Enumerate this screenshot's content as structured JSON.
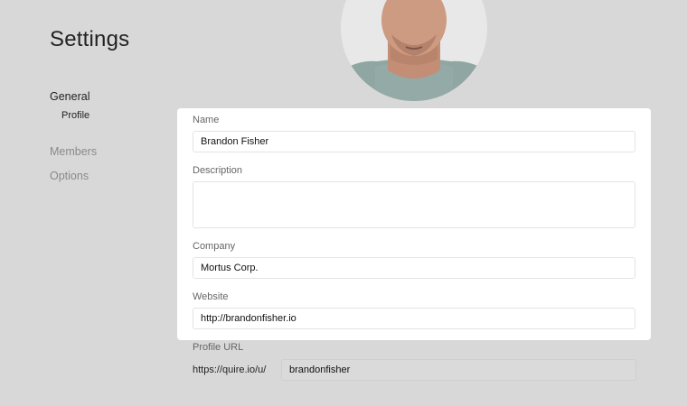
{
  "page": {
    "title": "Settings"
  },
  "nav": {
    "general": "General",
    "profile": "Profile",
    "members": "Members",
    "options": "Options"
  },
  "form": {
    "name": {
      "label": "Name",
      "value": "Brandon Fisher"
    },
    "description": {
      "label": "Description",
      "value": ""
    },
    "company": {
      "label": "Company",
      "value": "Mortus Corp."
    },
    "website": {
      "label": "Website",
      "value": "http://brandonfisher.io"
    },
    "profile_url": {
      "label": "Profile URL",
      "prefix": "https://quire.io/u/",
      "value": "brandonfisher"
    }
  },
  "colors": {
    "background": "#d8d8d8",
    "card": "#ffffff",
    "muted_nav": "#8a8a8a",
    "url_field": "#dadada"
  }
}
